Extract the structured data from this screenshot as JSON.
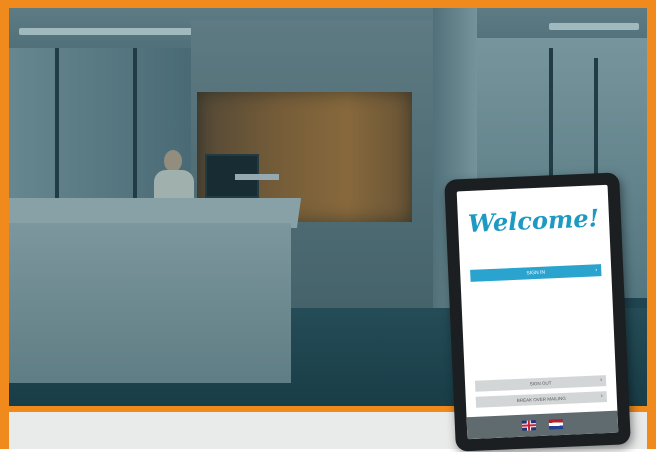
{
  "colors": {
    "frame_accent": "#f08a1c",
    "welcome_text": "#1e9ac2",
    "primary_button": "#2aa3cf",
    "secondary_button": "#d3d6d7",
    "flag_bar": "#606b70",
    "bottom_panel": "#e9ebea"
  },
  "kiosk": {
    "welcome": "Welcome!",
    "buttons": {
      "sign_in": "SIGN IN",
      "sign_out": "SIGN OUT",
      "other": "BREAK OVER MAILING"
    },
    "arrow_icon": "chevron-right-icon",
    "languages": [
      "english-flag-icon",
      "dutch-flag-icon"
    ]
  }
}
